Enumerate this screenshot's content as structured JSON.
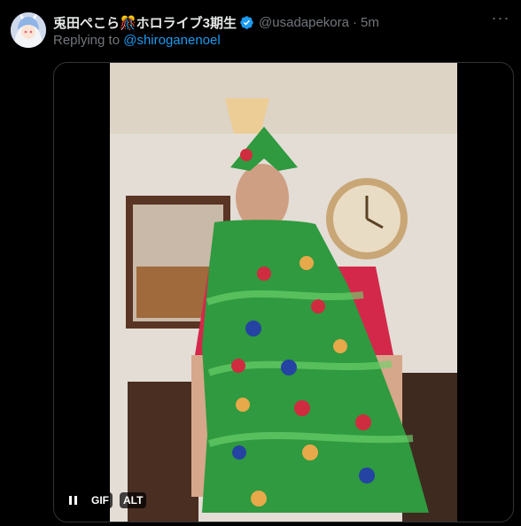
{
  "tweet": {
    "author": {
      "display_name": "兎田ぺこら🎊ホロライブ3期生",
      "handle": "@usadapekora",
      "verified": true
    },
    "separator": "·",
    "timestamp": "5m",
    "reply": {
      "prefix": "Replying to ",
      "mention": "@shiroganenoel"
    },
    "more_icon": "more-horizontal-icon",
    "media": {
      "type": "gif",
      "controls": {
        "pause_icon": "pause-icon",
        "gif_label": "GIF",
        "alt_label": "ALT"
      }
    }
  },
  "colors": {
    "background": "#000000",
    "primary_text": "#e7e9ea",
    "secondary_text": "#71767b",
    "accent": "#1d9bf0",
    "border": "#2f3336"
  }
}
